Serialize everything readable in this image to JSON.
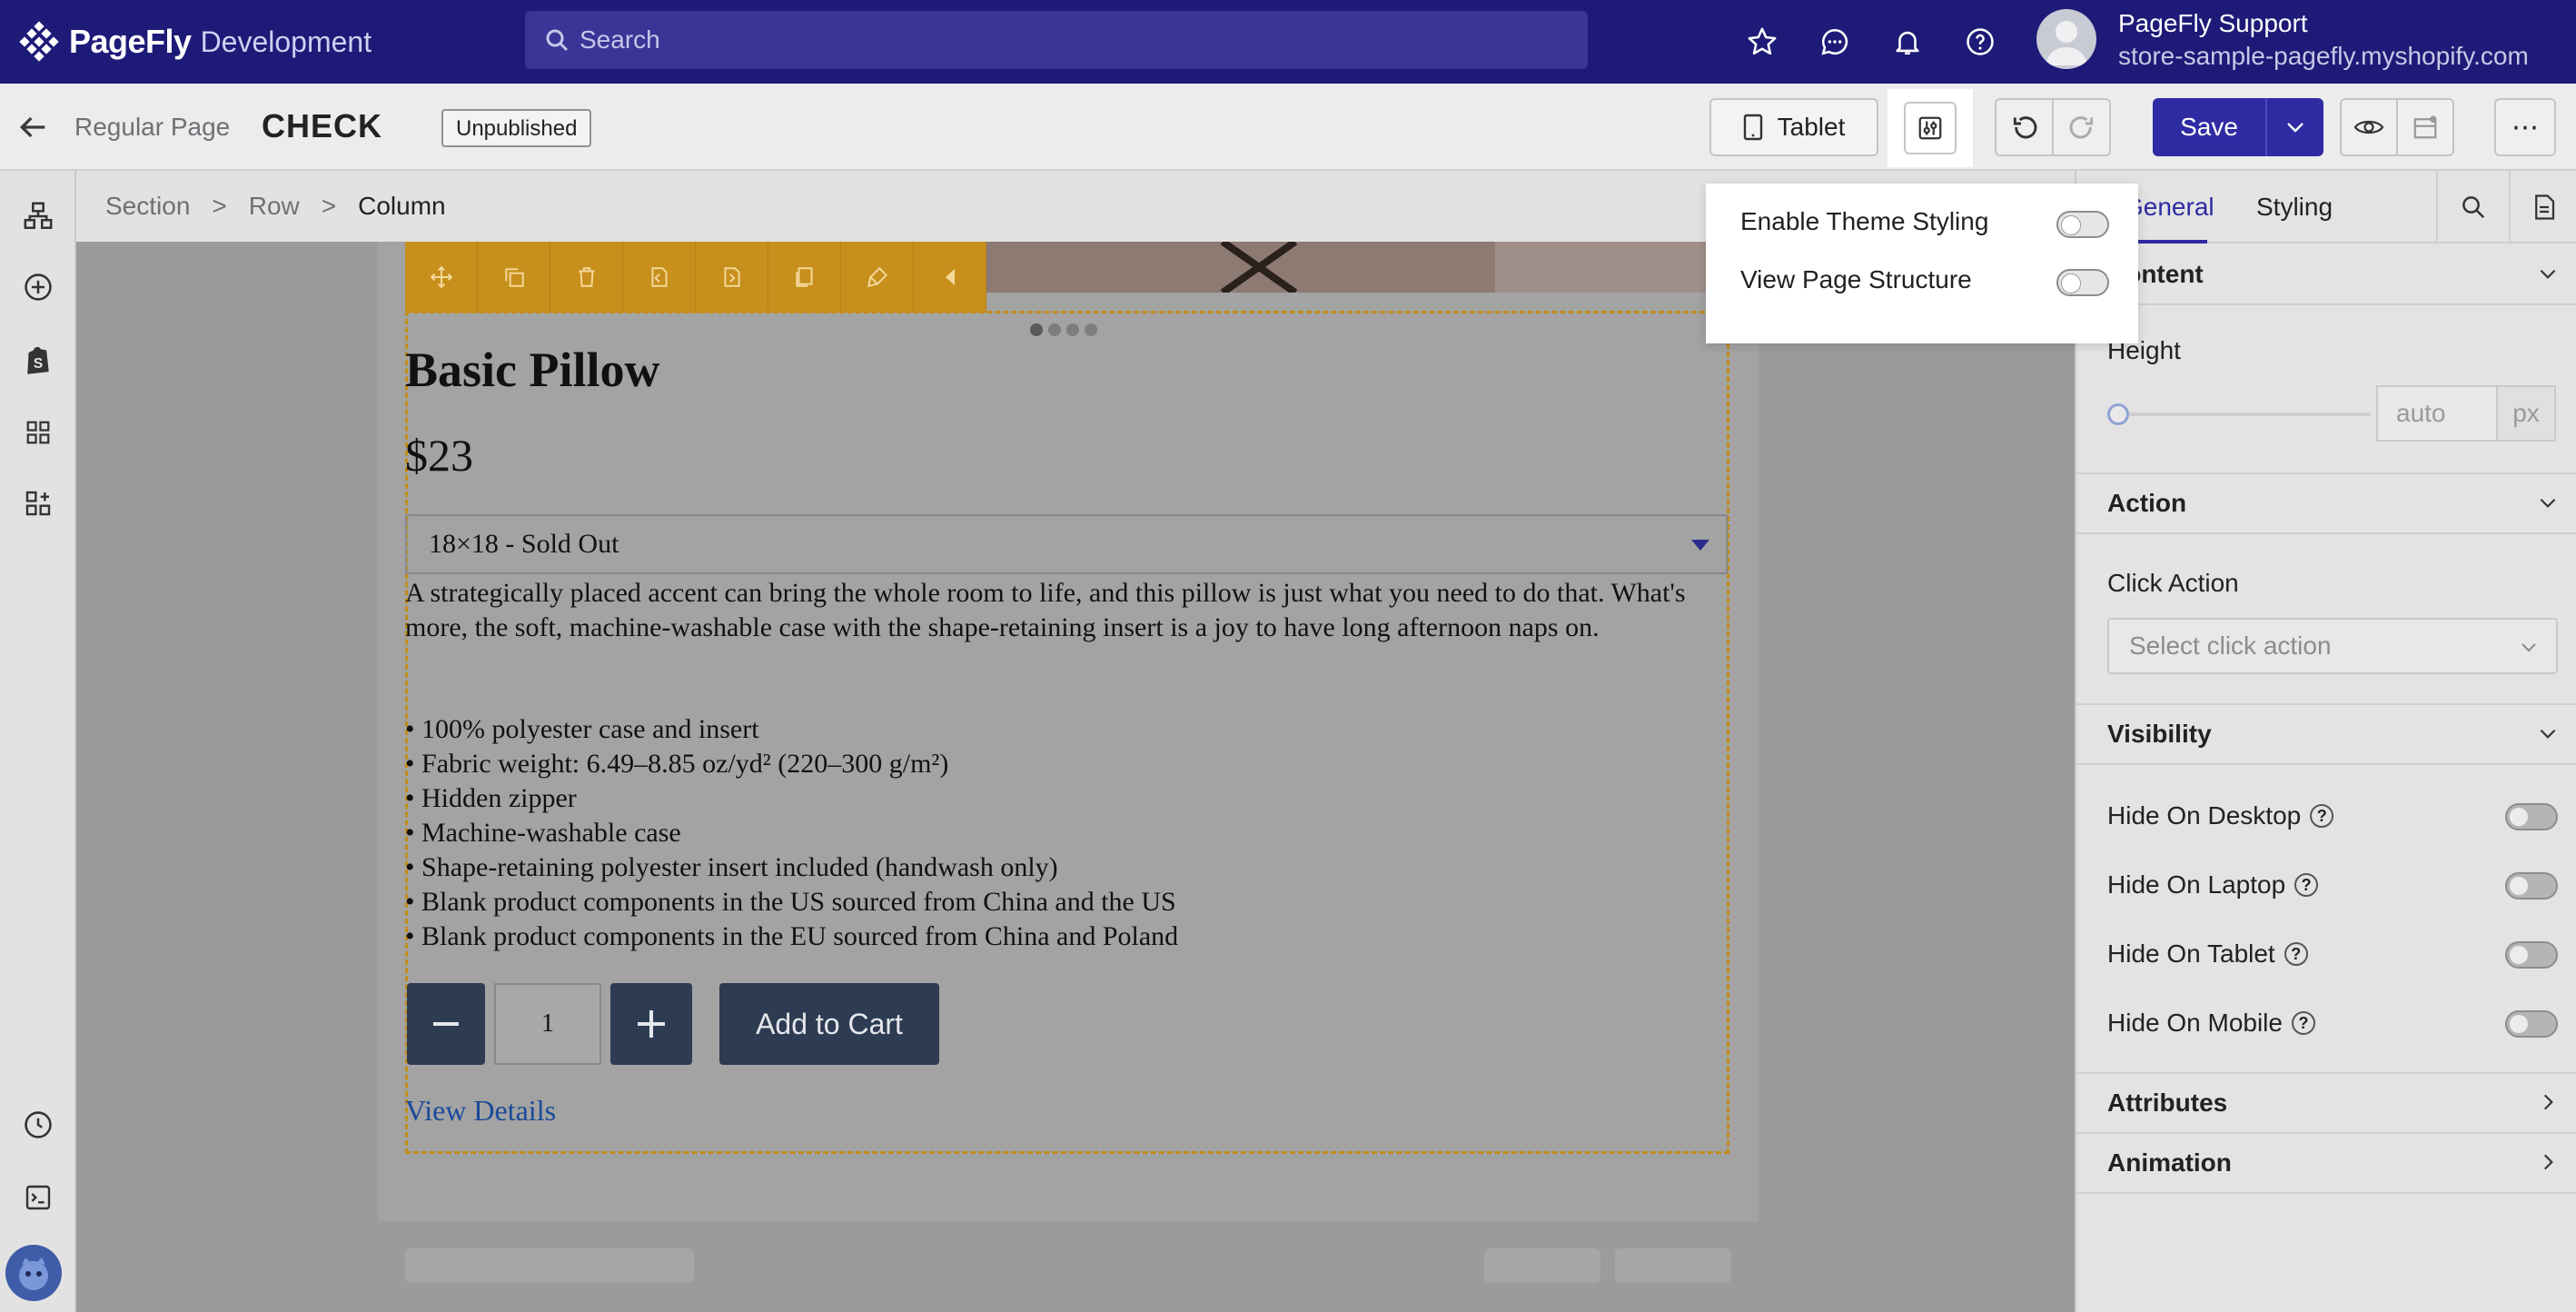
{
  "topbar": {
    "brand": "PageFly",
    "environment": "Development",
    "search_placeholder": "Search",
    "icons": [
      "star-icon",
      "chat-icon",
      "bell-icon",
      "help-icon"
    ],
    "user_name": "PageFly Support",
    "user_store": "store-sample-pagefly.myshopify.com"
  },
  "subbar": {
    "page_type": "Regular Page",
    "page_name": "CHECK",
    "status": "Unpublished",
    "device": "Tablet",
    "save_label": "Save"
  },
  "breadcrumb": {
    "items": [
      "Section",
      "Row",
      "Column"
    ],
    "separator": ">"
  },
  "product": {
    "title": "Basic Pillow",
    "price": "$23",
    "variant": "18×18 - Sold Out",
    "description": "A strategically placed accent can bring the whole room to life, and this pillow is just what you need to do that. What's more, the soft, machine-washable case with the shape-retaining insert is a joy to have long afternoon naps on.",
    "bullets": [
      "• 100% polyester case and insert",
      "• Fabric weight: 6.49–8.85 oz/yd² (220–300 g/m²)",
      "• Hidden zipper",
      "• Machine-washable case",
      "• Shape-retaining polyester insert included (handwash only)",
      "• Blank product components in the US sourced from China and the US",
      "• Blank product components in the EU sourced from China and Poland"
    ],
    "quantity": "1",
    "add_to_cart": "Add to Cart",
    "view_details": "View Details"
  },
  "popover": {
    "enable_theme_styling": "Enable Theme Styling",
    "view_page_structure": "View Page Structure"
  },
  "right_panel": {
    "tabs": {
      "general": "General",
      "styling": "Styling"
    },
    "content_header": "Content",
    "height_label": "Height",
    "height_value": "auto",
    "height_unit": "px",
    "action_header": "Action",
    "click_action_label": "Click Action",
    "click_action_placeholder": "Select click action",
    "visibility_header": "Visibility",
    "hide_desktop": "Hide On Desktop",
    "hide_laptop": "Hide On Laptop",
    "hide_tablet": "Hide On Tablet",
    "hide_mobile": "Hide On Mobile",
    "attributes_header": "Attributes",
    "animation_header": "Animation"
  },
  "colors": {
    "topbar": "#1e1a78",
    "primary": "#2e2ba3",
    "selection": "#c78f1c"
  }
}
